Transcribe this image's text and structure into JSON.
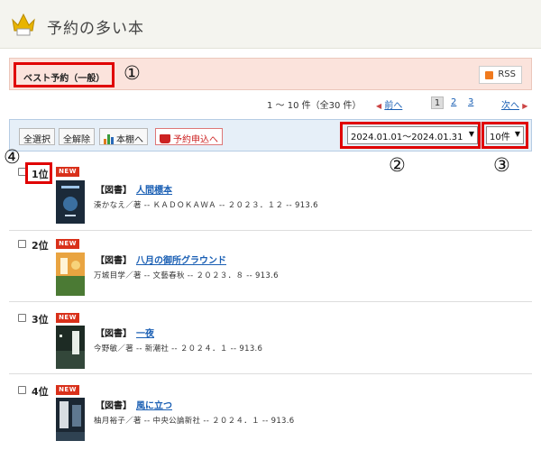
{
  "page": {
    "title": "予約の多い本"
  },
  "section": {
    "label": "ベスト予約（一般）",
    "rss": "RSS"
  },
  "annotations": {
    "a1": "①",
    "a2": "②",
    "a3": "③",
    "a4": "④"
  },
  "pager": {
    "count": "1 〜 10 件（全30 件）",
    "prev": "前へ",
    "pages": [
      "1",
      "2",
      "3"
    ],
    "current": "1",
    "next": "次へ"
  },
  "toolbar": {
    "select_all": "全選択",
    "deselect_all": "全解除",
    "shelf": "本棚へ",
    "reserve": "予約申込へ",
    "period": "2024.01.01〜2024.01.31",
    "per_page": "10件"
  },
  "badge": "NEW",
  "items": [
    {
      "rank": "1位",
      "kind": "【図書】",
      "title": "人間標本",
      "meta": "湊かなえ／著 -- ＫＡＤＯＫＡＷＡ -- ２０２３．１２ -- 913.6"
    },
    {
      "rank": "2位",
      "kind": "【図書】",
      "title": "八月の御所グラウンド",
      "meta": "万城目学／著 -- 文藝春秋 -- ２０２３．８ -- 913.6"
    },
    {
      "rank": "3位",
      "kind": "【図書】",
      "title": "一夜",
      "meta": "今野敏／著 -- 新潮社 -- ２０２４．１ -- 913.6"
    },
    {
      "rank": "4位",
      "kind": "【図書】",
      "title": "風に立つ",
      "meta": "柚月裕子／著 -- 中央公論新社 -- ２０２４．１ -- 913.6"
    }
  ],
  "colors": {
    "accent_red": "#e00000",
    "link": "#1a5fb4",
    "badge": "#d9301a",
    "section_bg": "#fbe3dc",
    "toolbar_bg": "#e6eff8"
  }
}
